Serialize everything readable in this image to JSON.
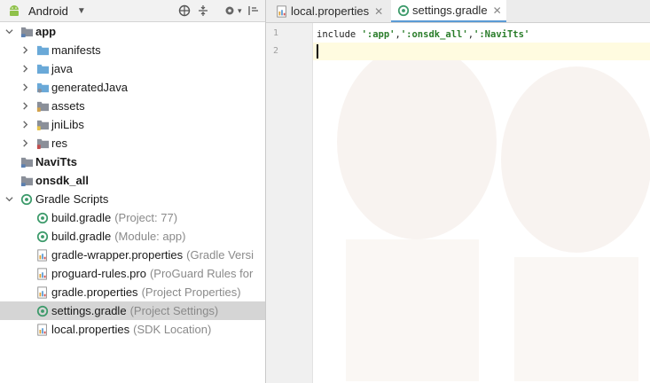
{
  "toolbar": {
    "view_label": "Android",
    "icons": [
      "android-icon",
      "dropdown-icon",
      "sync-icon",
      "collapse-icon",
      "gear-icon",
      "hide-panel-icon"
    ]
  },
  "tree": [
    {
      "label": "app",
      "bold": true,
      "hint": "",
      "icon": "module-folder-icon",
      "arrow": "expanded",
      "indent": 0
    },
    {
      "label": "manifests",
      "bold": false,
      "hint": "",
      "icon": "folder-icon",
      "arrow": "collapsed",
      "indent": 1
    },
    {
      "label": "java",
      "bold": false,
      "hint": "",
      "icon": "folder-icon",
      "arrow": "collapsed",
      "indent": 1
    },
    {
      "label": "generatedJava",
      "bold": false,
      "hint": "",
      "icon": "generated-folder-icon",
      "arrow": "collapsed",
      "indent": 1
    },
    {
      "label": "assets",
      "bold": false,
      "hint": "",
      "icon": "assets-folder-icon",
      "arrow": "collapsed",
      "indent": 1
    },
    {
      "label": "jniLibs",
      "bold": false,
      "hint": "",
      "icon": "jnilibs-folder-icon",
      "arrow": "collapsed",
      "indent": 1
    },
    {
      "label": "res",
      "bold": false,
      "hint": "",
      "icon": "res-folder-icon",
      "arrow": "collapsed",
      "indent": 1
    },
    {
      "label": "NaviTts",
      "bold": true,
      "hint": "",
      "icon": "module-folder-icon",
      "arrow": "none",
      "indent": 0
    },
    {
      "label": "onsdk_all",
      "bold": true,
      "hint": "",
      "icon": "module-folder-icon",
      "arrow": "none",
      "indent": 0
    },
    {
      "label": "Gradle Scripts",
      "bold": false,
      "hint": "",
      "icon": "gradle-icon",
      "arrow": "expanded",
      "indent": 0
    },
    {
      "label": "build.gradle",
      "bold": false,
      "hint": "(Project: 77)",
      "icon": "gradle-icon",
      "arrow": "none",
      "indent": 1
    },
    {
      "label": "build.gradle",
      "bold": false,
      "hint": "(Module: app)",
      "icon": "gradle-icon",
      "arrow": "none",
      "indent": 1
    },
    {
      "label": "gradle-wrapper.properties",
      "bold": false,
      "hint": "(Gradle Versi",
      "icon": "properties-icon",
      "arrow": "none",
      "indent": 1
    },
    {
      "label": "proguard-rules.pro",
      "bold": false,
      "hint": "(ProGuard Rules for",
      "icon": "properties-icon",
      "arrow": "none",
      "indent": 1
    },
    {
      "label": "gradle.properties",
      "bold": false,
      "hint": "(Project Properties)",
      "icon": "properties-icon",
      "arrow": "none",
      "indent": 1
    },
    {
      "label": "settings.gradle",
      "bold": false,
      "hint": "(Project Settings)",
      "icon": "gradle-icon",
      "arrow": "none",
      "indent": 1,
      "selected": true
    },
    {
      "label": "local.properties",
      "bold": false,
      "hint": "(SDK Location)",
      "icon": "properties-icon",
      "arrow": "none",
      "indent": 1
    }
  ],
  "tabs": [
    {
      "label": "local.properties",
      "icon": "properties-icon",
      "active": false,
      "close": "✕"
    },
    {
      "label": "settings.gradle",
      "icon": "gradle-icon",
      "active": true,
      "close": "✕"
    }
  ],
  "editor": {
    "line_numbers": [
      "1",
      "2"
    ],
    "code_line_1": {
      "include_kw": "include ",
      "tokens": [
        "':app'",
        ",",
        "':onsdk_all'",
        ",",
        "':NaviTts'"
      ]
    },
    "current_line": 2
  },
  "colors": {
    "selection": "#d5d5d5",
    "current_line": "#fffbe0",
    "string": "#2a7d2a",
    "hint": "#8a8a8a",
    "gradle_green": "#3c9a6a",
    "folder_blue": "#6aa9d8"
  }
}
